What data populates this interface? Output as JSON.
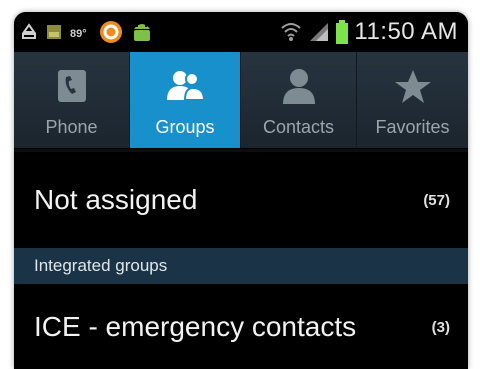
{
  "status_bar": {
    "time": "11:50 AM",
    "icons": [
      "recycle-icon",
      "image-icon",
      "signal-4g-icon",
      "app-circle-icon",
      "android-icon",
      "wifi-icon",
      "cell-signal-icon",
      "battery-icon"
    ],
    "battery_color": "#7ee34a"
  },
  "tabs": [
    {
      "label": "Phone",
      "icon": "phone-icon",
      "active": false
    },
    {
      "label": "Groups",
      "icon": "groups-icon",
      "active": true
    },
    {
      "label": "Contacts",
      "icon": "contact-icon",
      "active": false
    },
    {
      "label": "Favorites",
      "icon": "star-icon",
      "active": false
    }
  ],
  "list": {
    "not_assigned": {
      "title": "Not assigned",
      "count": "(57)"
    },
    "section_header": "Integrated groups",
    "ice": {
      "title": "ICE - emergency contacts",
      "count": "(3)"
    }
  },
  "colors": {
    "active_tab": "#1890cc",
    "section_header_bg": "#1a3346",
    "background": "#000000"
  }
}
